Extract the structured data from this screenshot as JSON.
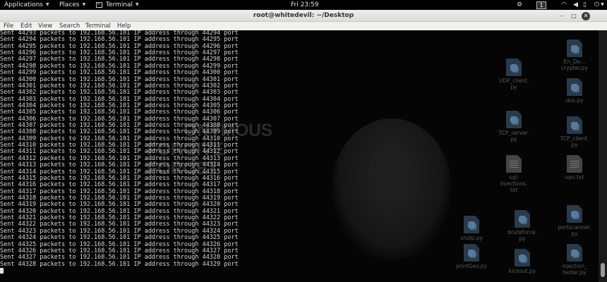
{
  "topbar": {
    "applications": "Applications",
    "places": "Places",
    "terminal": "Terminal",
    "clock": "Fri 23:59",
    "workspace": "1"
  },
  "window": {
    "title": "root@whitedevil: ~/Desktop"
  },
  "menu": [
    "File",
    "Edit",
    "View",
    "Search",
    "Terminal",
    "Help"
  ],
  "terminal": {
    "sent_word": "Sent",
    "packets_to": "packets to",
    "target_ip": "192.168.56.101",
    "ip_through": "IP address through",
    "port_word": "port",
    "first_packet": 44293,
    "last_packet": 44328
  },
  "wallpaper": {
    "text": [
      "ONYMOUS",
      "FORGIVE",
      "FORGET"
    ]
  },
  "desktop_icons": [
    {
      "label": "En_De...\ncrypter.py",
      "kind": "py"
    },
    {
      "label": "UDP_client.\npy",
      "kind": "py"
    },
    {
      "label": "dos.py",
      "kind": "py"
    },
    {
      "label": "TCP_server.\npy",
      "kind": "py"
    },
    {
      "label": "TCP_client.\npy",
      "kind": "py"
    },
    {
      "label": "sql-\ninjections.\ntxt",
      "kind": "txt"
    },
    {
      "label": "vpn.txt",
      "kind": "txt"
    },
    {
      "label": "unzip.py",
      "kind": "py"
    },
    {
      "label": "bruteforce.\npy",
      "kind": "py"
    },
    {
      "label": "portscanner.\npy",
      "kind": "py"
    },
    {
      "label": "printGeo.py",
      "kind": "py"
    },
    {
      "label": "kickout.py",
      "kind": "py"
    },
    {
      "label": "injection_\ntester.py",
      "kind": "py"
    }
  ]
}
